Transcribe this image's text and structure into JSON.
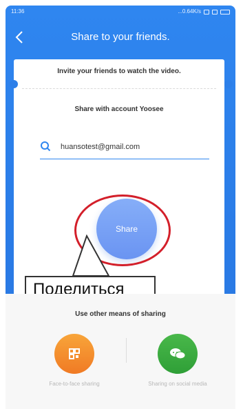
{
  "statusbar": {
    "time": "11:36",
    "network": "...0.64K/s"
  },
  "header": {
    "title": "Share to your friends."
  },
  "card": {
    "invite_text": "Invite your friends to watch the video.",
    "share_with_account": "Share with account Yoosee",
    "email_value": "huansotest@gmail.com",
    "share_button_label": "Share"
  },
  "annotation": {
    "callout_text": "Поделиться",
    "highlight_color": "#d31f2a"
  },
  "bottom": {
    "title": "Use other means of sharing",
    "options": [
      {
        "label": "Face-to-face sharing",
        "icon": "qr-code-icon",
        "color": "#f3872a"
      },
      {
        "label": "Sharing on social media",
        "icon": "chat-bubbles-icon",
        "color": "#3fae3f"
      }
    ]
  },
  "colors": {
    "primary": "#2f86f0",
    "share_button": "#7ea4f6"
  }
}
